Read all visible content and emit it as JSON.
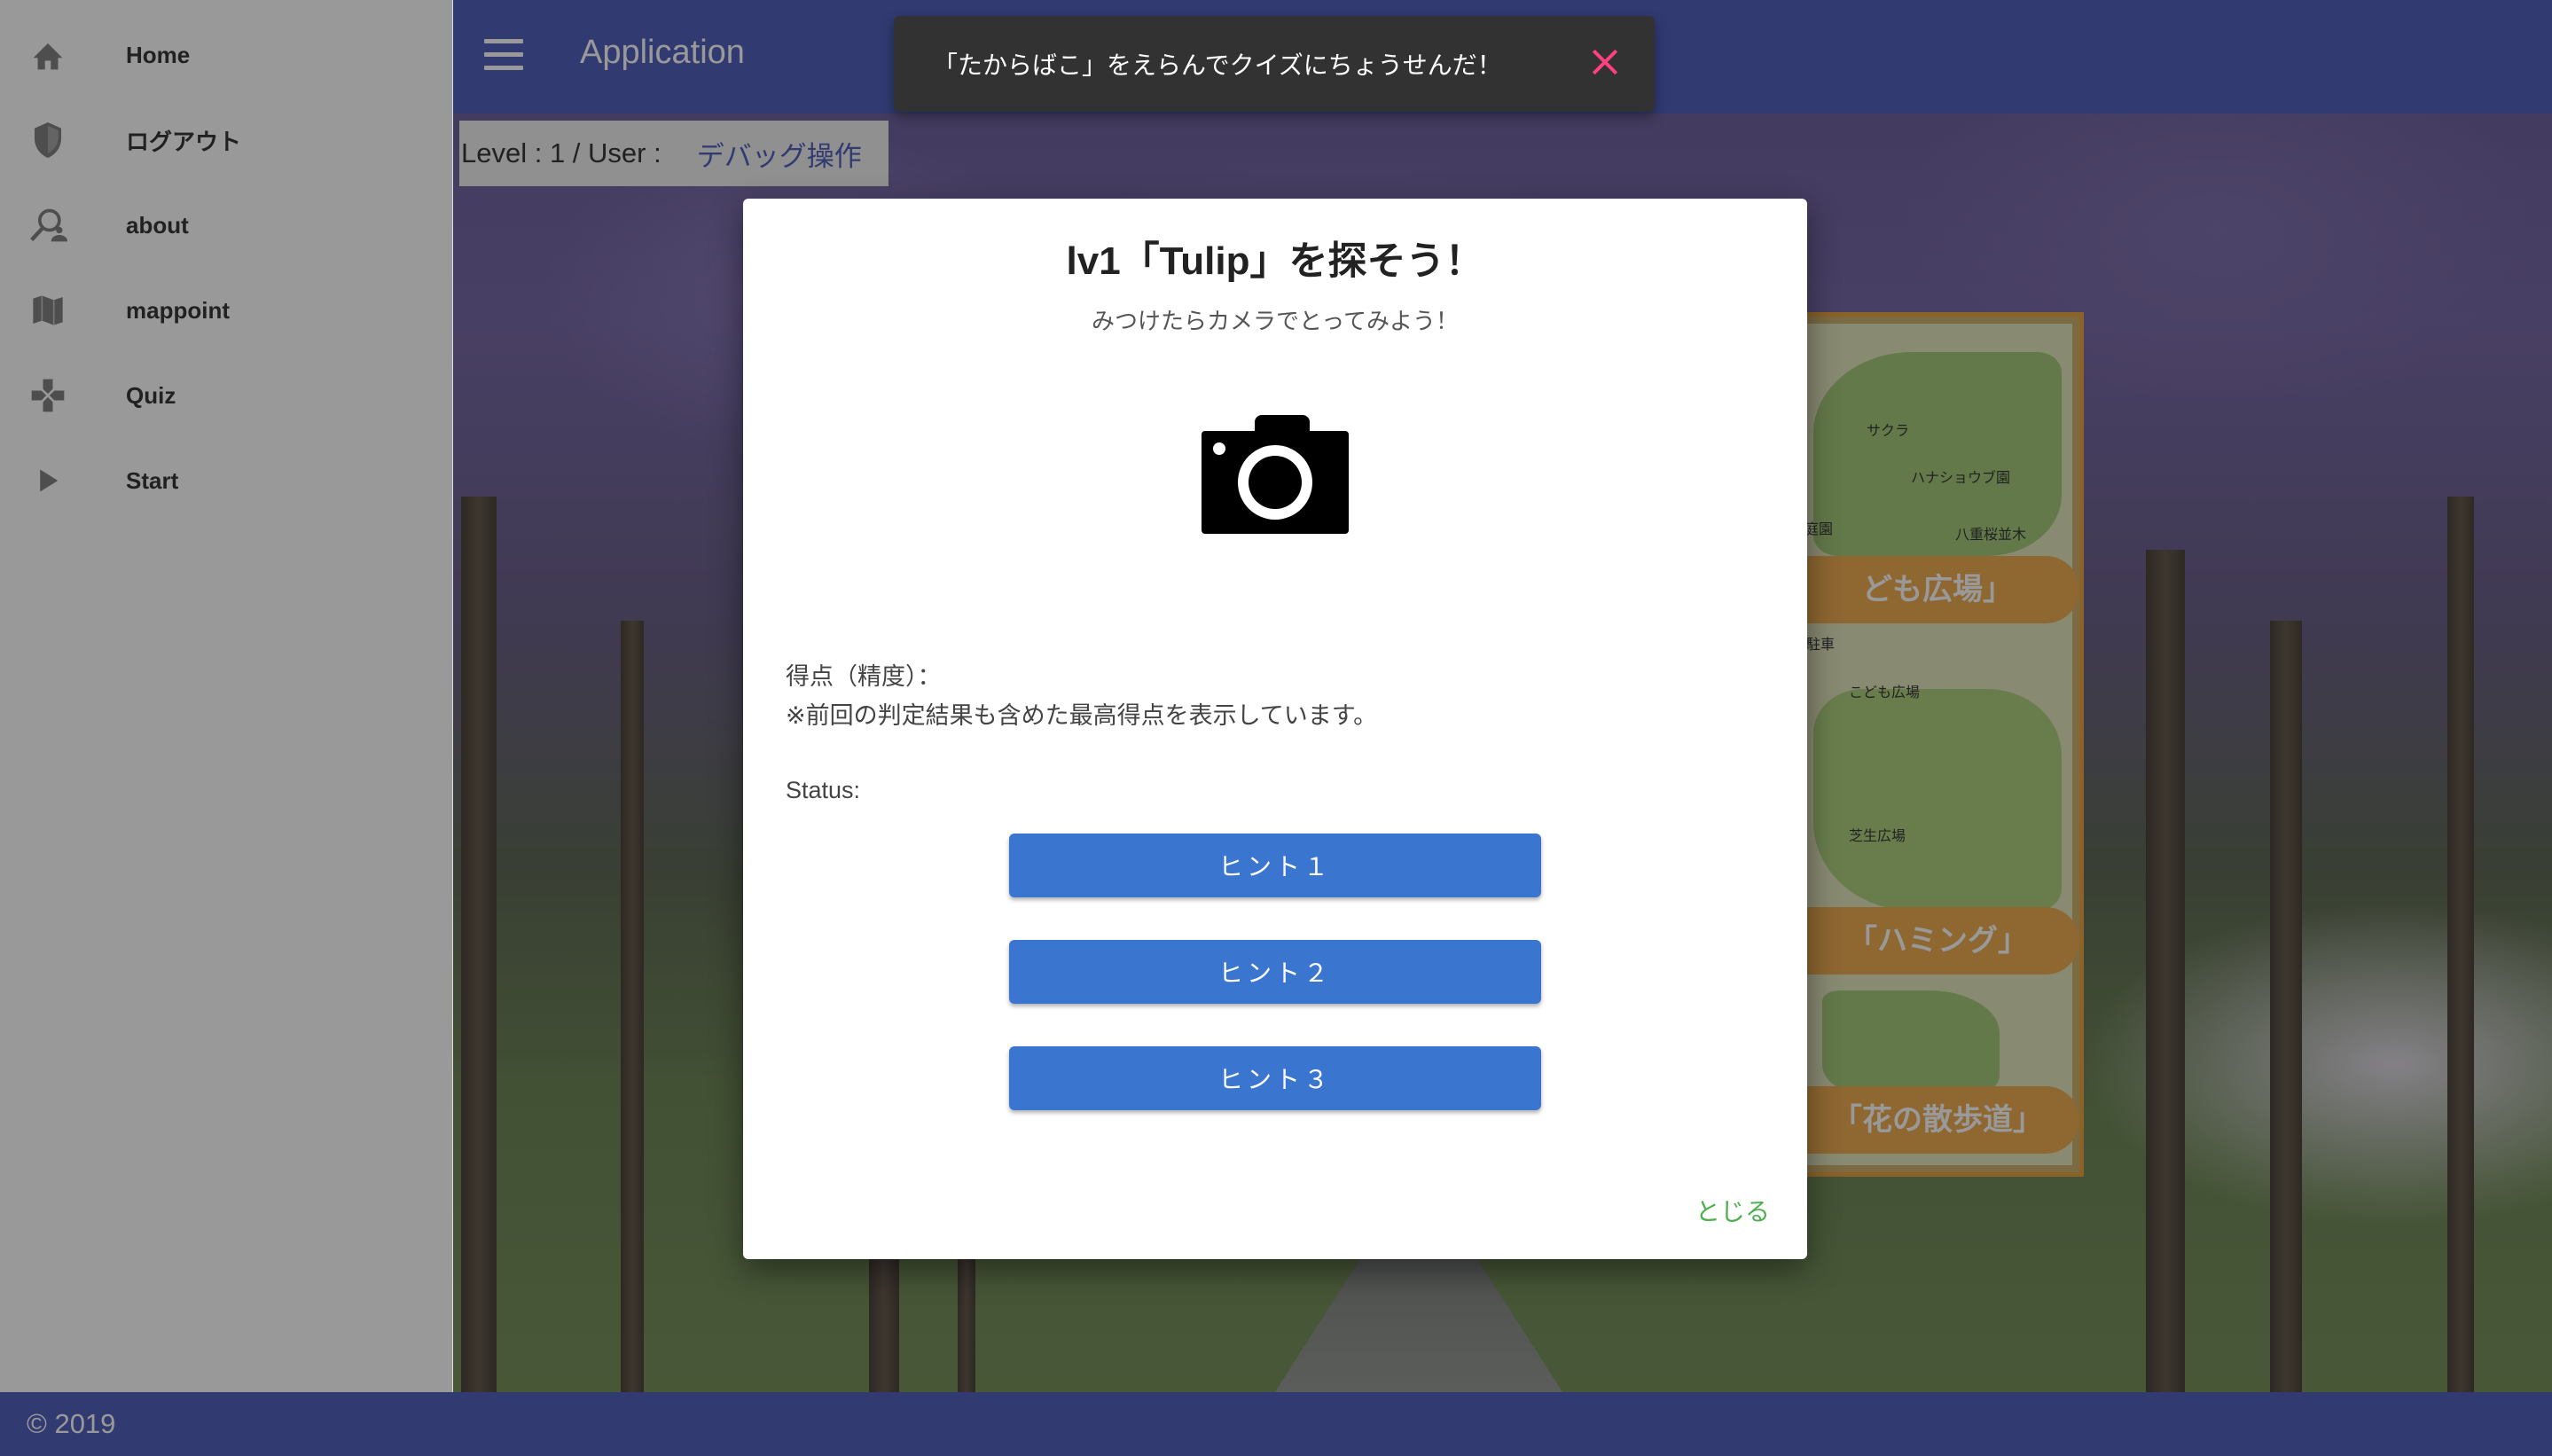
{
  "app": {
    "title": "Application"
  },
  "level_panel": {
    "label": "Level : 1 / User :",
    "debug_label": "デバッグ操作"
  },
  "drawer": {
    "items": [
      {
        "label": "Home",
        "icon": "home-icon"
      },
      {
        "label": "ログアウト",
        "icon": "shield-icon"
      },
      {
        "label": "about",
        "icon": "person-search-icon"
      },
      {
        "label": "mappoint",
        "icon": "map-icon"
      },
      {
        "label": "Quiz",
        "icon": "gamepad-icon"
      },
      {
        "label": "Start",
        "icon": "play-icon"
      }
    ]
  },
  "snackbar": {
    "message": "「たからばこ」をえらんでクイズにちょうせんだ！",
    "close_icon": "close-icon",
    "close_color": "#ff4081"
  },
  "dialog": {
    "title": "lv1「Tulip」を探そう！",
    "subtitle": "みつけたらカメラでとってみよう！",
    "camera_icon": "camera-icon",
    "score_label": "得点（精度）：",
    "score_note": "※前回の判定結果も含めた最高得点を表示しています。",
    "status_label": "Status:",
    "hints": [
      "ヒント１",
      "ヒント２",
      "ヒント３"
    ],
    "close_label": "とじる"
  },
  "background_sign": {
    "labels": [
      "ども広場」",
      "「ハミング」",
      "「花の散歩道」"
    ],
    "small_labels": [
      "サクラ",
      "ハナショウブ園",
      "八重桜並木",
      "庭園",
      "駐車",
      "こども広場",
      "芝生広場"
    ]
  },
  "footer": {
    "copyright": "© 2019"
  },
  "colors": {
    "primary": "#3f51b5",
    "hint_button": "#3a76cf",
    "close_text": "#4caf50",
    "snackbar_bg": "#323232"
  }
}
